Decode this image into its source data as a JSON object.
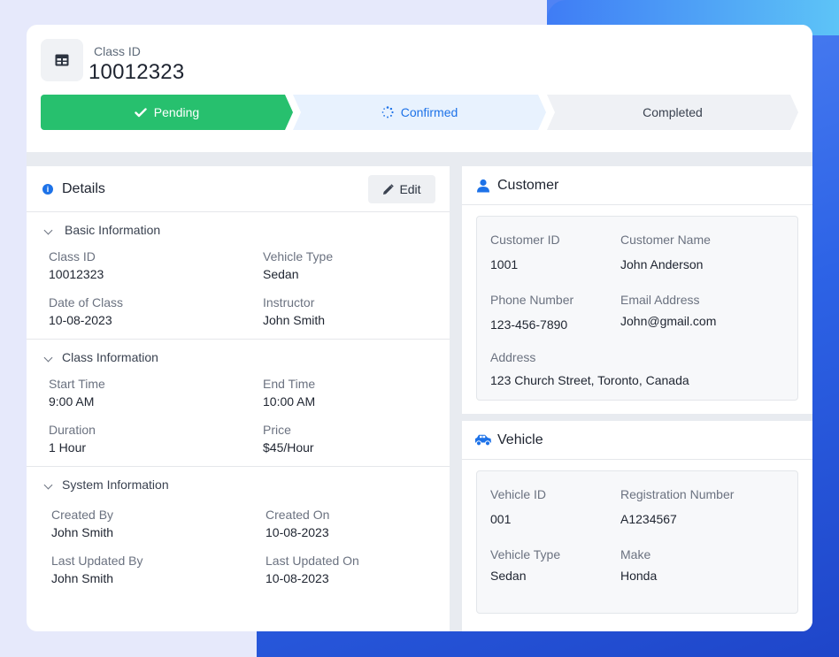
{
  "header": {
    "label": "Class ID",
    "value": "10012323"
  },
  "steps": [
    {
      "label": "Pending",
      "state": "done"
    },
    {
      "label": "Confirmed",
      "state": "active"
    },
    {
      "label": "Completed",
      "state": "upcoming"
    }
  ],
  "details": {
    "title": "Details",
    "edit_label": "Edit",
    "basic": {
      "title": "Basic Information",
      "class_id_label": "Class ID",
      "class_id": "10012323",
      "vehicle_type_label": "Vehicle Type",
      "vehicle_type": "Sedan",
      "date_label": "Date of Class",
      "date": "10-08-2023",
      "instructor_label": "Instructor",
      "instructor": "John Smith"
    },
    "class": {
      "title": "Class Information",
      "start_label": "Start Time",
      "start": "9:00 AM",
      "end_label": "End Time",
      "end": "10:00 AM",
      "duration_label": "Duration",
      "duration": "1 Hour",
      "price_label": "Price",
      "price": "$45/Hour"
    },
    "system": {
      "title": "System Information",
      "created_by_label": "Created By",
      "created_by": "John Smith",
      "created_on_label": "Created On",
      "created_on": "10-08-2023",
      "updated_by_label": "Last Updated By",
      "updated_by": "John Smith",
      "updated_on_label": "Last Updated On",
      "updated_on": "10-08-2023"
    }
  },
  "customer": {
    "title": "Customer",
    "id_label": "Customer ID",
    "id": "1001",
    "name_label": "Customer Name",
    "name": "John Anderson",
    "phone_label": "Phone Number",
    "phone": "123-456-7890",
    "email_label": "Email Address",
    "email": "John@gmail.com",
    "address_label": "Address",
    "address": "123 Church Street, Toronto, Canada"
  },
  "vehicle": {
    "title": "Vehicle",
    "id_label": "Vehicle ID",
    "id": "001",
    "reg_label": "Registration Number",
    "reg": "A1234567",
    "type_label": "Vehicle Type",
    "type": "Sedan",
    "make_label": "Make",
    "make": "Honda"
  },
  "colors": {
    "accent": "#1d72e8",
    "success": "#27c06e",
    "background": "#e6e9fb"
  }
}
